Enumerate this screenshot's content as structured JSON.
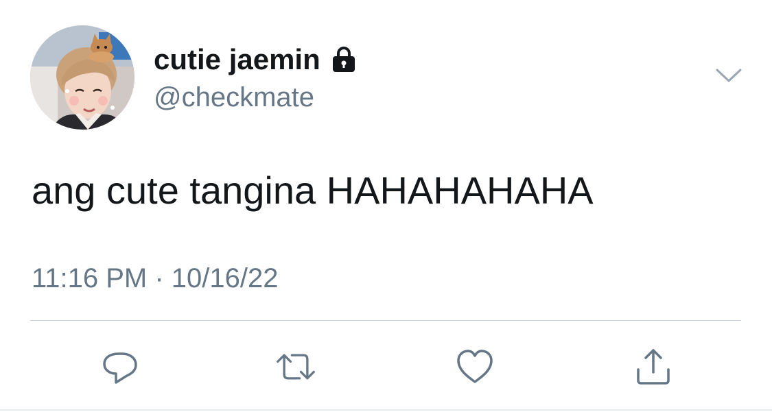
{
  "tweet": {
    "display_name": "cutie jaemin",
    "handle": "@checkmate",
    "text": "ang cute tangina HAHAHAHAHA",
    "timestamp": "11:16 PM · 10/16/22",
    "protected": true
  },
  "icons": {
    "lock": "lock-icon",
    "more": "chevron-down-icon",
    "reply": "reply-icon",
    "retweet": "retweet-icon",
    "like": "heart-icon",
    "share": "share-icon"
  },
  "colors": {
    "text": "#14171a",
    "secondary": "#657786",
    "icon": "#657786",
    "divider": "#ccd6dd"
  }
}
